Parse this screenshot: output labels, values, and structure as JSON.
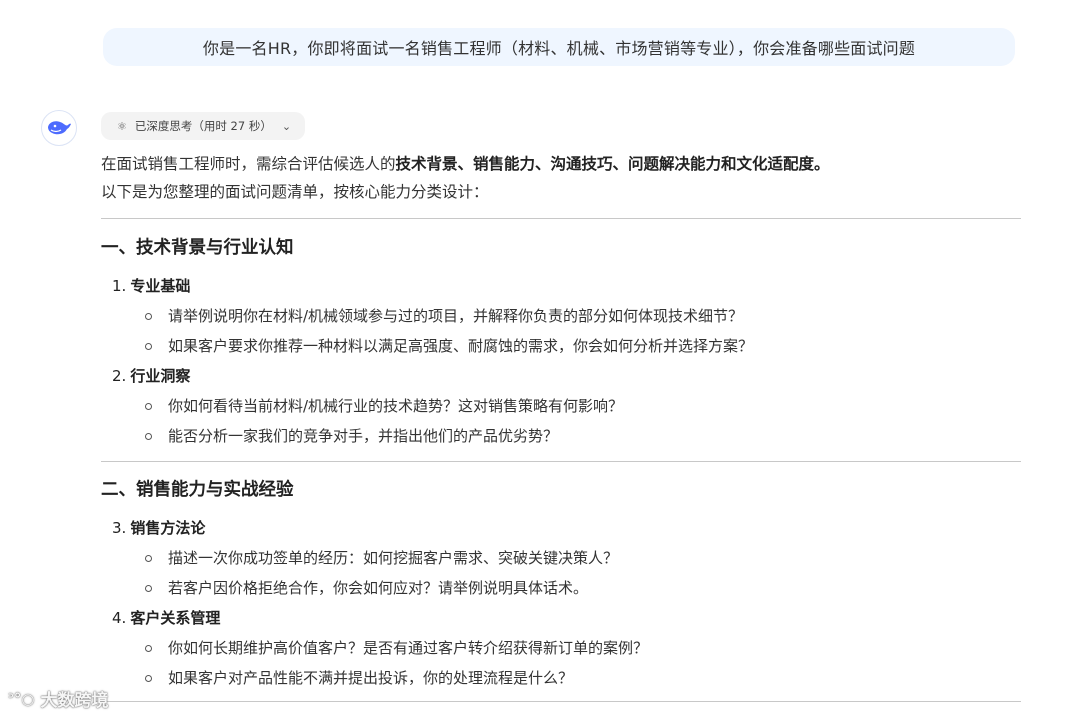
{
  "user_message": "你是一名HR，你即将面试一名销售工程师（材料、机械、市场营销等专业），你会准备哪些面试问题",
  "thinking": {
    "label": "已深度思考（用时 27 秒）"
  },
  "answer": {
    "intro_plain_1": "在面试销售工程师时，需综合评估候选人的",
    "intro_bold": "技术背景、销售能力、沟通技巧、问题解决能力和文化适配度。",
    "intro_line_2": "以下是为您整理的面试问题清单，按核心能力分类设计：",
    "sections": [
      {
        "title": "一、技术背景与行业认知",
        "subs": [
          {
            "num": "1.",
            "title": "专业基础",
            "bullets": [
              "请举例说明你在材料/机械领域参与过的项目，并解释你负责的部分如何体现技术细节？",
              "如果客户要求你推荐一种材料以满足高强度、耐腐蚀的需求，你会如何分析并选择方案？"
            ]
          },
          {
            "num": "2.",
            "title": "行业洞察",
            "bullets": [
              "你如何看待当前材料/机械行业的技术趋势？这对销售策略有何影响？",
              "能否分析一家我们的竞争对手，并指出他们的产品优劣势？"
            ]
          }
        ]
      },
      {
        "title": "二、销售能力与实战经验",
        "subs": [
          {
            "num": "3.",
            "title": "销售方法论",
            "bullets": [
              "描述一次你成功签单的经历：如何挖掘客户需求、突破关键决策人？",
              "若客户因价格拒绝合作，你会如何应对？请举例说明具体话术。"
            ]
          },
          {
            "num": "4.",
            "title": "客户关系管理",
            "bullets": [
              "你如何长期维护高价值客户？是否有通过客户转介绍获得新订单的案例？",
              "如果客户对产品性能不满并提出投诉，你的处理流程是什么？"
            ]
          }
        ]
      }
    ]
  },
  "watermark": "大数跨境",
  "icons": {
    "avatar": "whale-logo-icon",
    "thinking": "atom-icon",
    "expand": "chevron-down-icon"
  },
  "colors": {
    "user_bubble": "#eff6ff",
    "avatar_blue": "#4d6bfe"
  }
}
